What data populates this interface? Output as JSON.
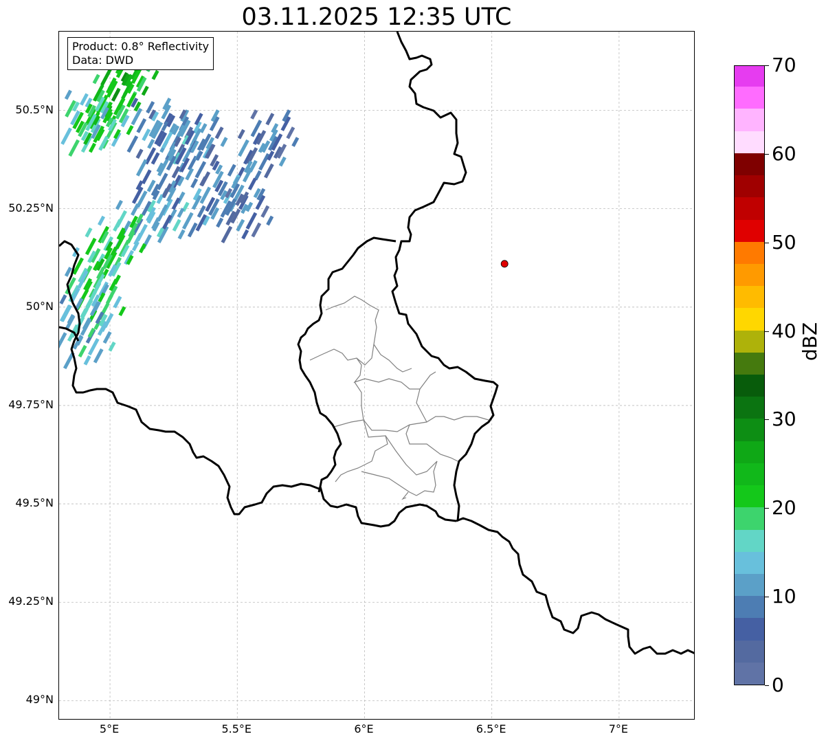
{
  "title": "03.11.2025 12:35 UTC",
  "info": {
    "product": "Product: 0.8° Reflectivity",
    "data": "Data: DWD"
  },
  "axes": {
    "lon_range": [
      4.8,
      7.3
    ],
    "lat_range": [
      48.95,
      50.7
    ],
    "lon_ticks": [
      {
        "value": 5.0,
        "label": "5°E"
      },
      {
        "value": 5.5,
        "label": "5.5°E"
      },
      {
        "value": 6.0,
        "label": "6°E"
      },
      {
        "value": 6.5,
        "label": "6.5°E"
      },
      {
        "value": 7.0,
        "label": "7°E"
      }
    ],
    "lat_ticks": [
      {
        "value": 50.5,
        "label": "50.5°N"
      },
      {
        "value": 50.25,
        "label": "50.25°N"
      },
      {
        "value": 50.0,
        "label": "50°N"
      },
      {
        "value": 49.75,
        "label": "49.75°N"
      },
      {
        "value": 49.5,
        "label": "49.5°N"
      },
      {
        "value": 49.25,
        "label": "49.25°N"
      },
      {
        "value": 49.0,
        "label": "49°N"
      }
    ],
    "grid": true
  },
  "marker": {
    "lon": 6.55,
    "lat": 50.11,
    "color": "#e00000"
  },
  "colorbar": {
    "label": "dBZ",
    "min": 0,
    "max": 70,
    "tick_values": [
      0,
      10,
      20,
      30,
      40,
      50,
      60,
      70
    ],
    "colors": [
      "#6073a6",
      "#546aa0",
      "#4560a3",
      "#4d7db3",
      "#5ba0c8",
      "#68c0dc",
      "#62d6c6",
      "#3dd46d",
      "#14c81a",
      "#11b81a",
      "#0fa816",
      "#0d8e14",
      "#0b7411",
      "#085c0b",
      "#457a0e",
      "#aeb20a",
      "#ffd700",
      "#ffbb00",
      "#ff9a00",
      "#ff7a00",
      "#e00000",
      "#c00000",
      "#a00000",
      "#7f0000",
      "#ffdcff",
      "#ffb4ff",
      "#ff6cff",
      "#e63cf0"
    ]
  },
  "reflectivity_cells": [
    {
      "lon": 5.03,
      "lat": 50.54,
      "dbz": 22
    },
    {
      "lon": 5.06,
      "lat": 50.58,
      "dbz": 24
    },
    {
      "lon": 5.0,
      "lat": 50.48,
      "dbz": 18
    },
    {
      "lon": 4.95,
      "lat": 50.47,
      "dbz": 20
    },
    {
      "lon": 4.92,
      "lat": 50.5,
      "dbz": 16
    },
    {
      "lon": 5.1,
      "lat": 50.62,
      "dbz": 22
    },
    {
      "lon": 5.25,
      "lat": 50.45,
      "dbz": 8
    },
    {
      "lon": 5.3,
      "lat": 50.42,
      "dbz": 12
    },
    {
      "lon": 5.35,
      "lat": 50.38,
      "dbz": 8
    },
    {
      "lon": 5.6,
      "lat": 50.4,
      "dbz": 8
    },
    {
      "lon": 5.65,
      "lat": 50.45,
      "dbz": 6
    },
    {
      "lon": 5.5,
      "lat": 50.32,
      "dbz": 10
    },
    {
      "lon": 5.45,
      "lat": 50.28,
      "dbz": 8
    },
    {
      "lon": 5.55,
      "lat": 50.25,
      "dbz": 6
    },
    {
      "lon": 5.3,
      "lat": 50.25,
      "dbz": 12
    },
    {
      "lon": 5.2,
      "lat": 50.27,
      "dbz": 10
    },
    {
      "lon": 5.12,
      "lat": 50.22,
      "dbz": 14
    },
    {
      "lon": 5.05,
      "lat": 50.18,
      "dbz": 18
    },
    {
      "lon": 5.0,
      "lat": 50.15,
      "dbz": 20
    },
    {
      "lon": 4.95,
      "lat": 50.1,
      "dbz": 18
    },
    {
      "lon": 4.92,
      "lat": 50.05,
      "dbz": 16
    },
    {
      "lon": 4.97,
      "lat": 50.02,
      "dbz": 18
    },
    {
      "lon": 4.9,
      "lat": 49.98,
      "dbz": 12
    },
    {
      "lon": 4.93,
      "lat": 49.93,
      "dbz": 14
    },
    {
      "lon": 5.37,
      "lat": 50.45,
      "dbz": 8
    },
    {
      "lon": 5.2,
      "lat": 50.35,
      "dbz": 8
    },
    {
      "lon": 5.18,
      "lat": 50.48,
      "dbz": 10
    }
  ]
}
